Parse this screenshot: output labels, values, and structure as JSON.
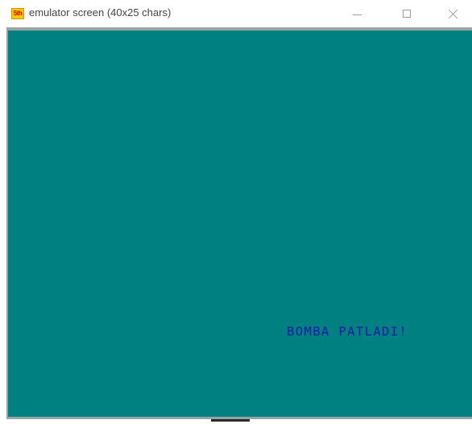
{
  "window": {
    "title": "emulator screen (40x25 chars)",
    "icon_label": "5th"
  },
  "controls": {
    "minimize_icon": "minimize-icon",
    "maximize_icon": "maximize-icon",
    "close_icon": "close-icon"
  },
  "screen": {
    "background_color": "#008080",
    "text_color": "#1a1aa6",
    "message": "BOMBA PATLADI!"
  }
}
